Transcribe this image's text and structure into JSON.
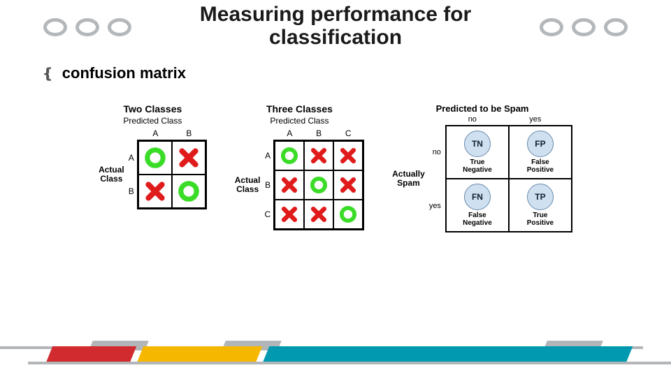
{
  "title_line1": "Measuring performance for",
  "title_line2": "classification",
  "bullet": "confusion matrix",
  "two": {
    "title": "Two Classes",
    "sub": "Predicted Class",
    "axis": "Actual\nClass",
    "cols": [
      "A",
      "B"
    ],
    "rows": [
      "A",
      "B"
    ]
  },
  "three": {
    "title": "Three Classes",
    "sub": "Predicted Class",
    "axis": "Actual\nClass",
    "cols": [
      "A",
      "B",
      "C"
    ],
    "rows": [
      "A",
      "B",
      "C"
    ]
  },
  "spam": {
    "title": "Predicted to be Spam",
    "cols": [
      "no",
      "yes"
    ],
    "axis": "Actually\nSpam",
    "rows": [
      "no",
      "yes"
    ],
    "cells": [
      {
        "abbr": "TN",
        "label": "True\nNegative"
      },
      {
        "abbr": "FP",
        "label": "False\nPositive"
      },
      {
        "abbr": "FN",
        "label": "False\nNegative"
      },
      {
        "abbr": "TP",
        "label": "True\nPositive"
      }
    ]
  }
}
